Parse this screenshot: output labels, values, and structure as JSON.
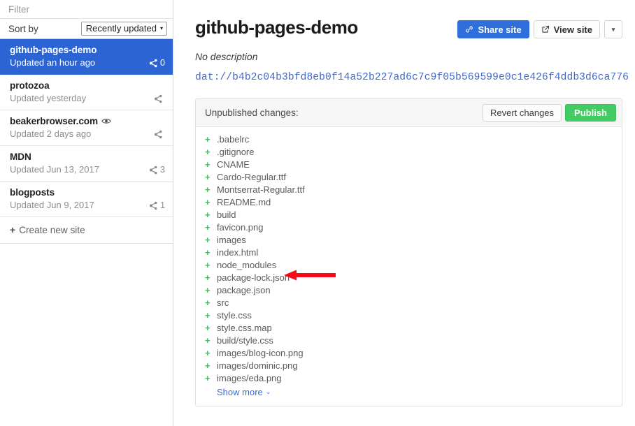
{
  "sidebar": {
    "filter": {
      "placeholder": "Filter",
      "value": ""
    },
    "sort": {
      "label": "Sort by",
      "selected": "Recently updated",
      "caret": "▾"
    },
    "sites": [
      {
        "name": "github-pages-demo",
        "updated": "Updated an hour ago",
        "peers": "0",
        "selected": true,
        "has_eye": false,
        "share_icon": "share-icon"
      },
      {
        "name": "protozoa",
        "updated": "Updated yesterday",
        "peers": "",
        "selected": false,
        "has_eye": false,
        "share_icon": "share-icon"
      },
      {
        "name": "beakerbrowser.com",
        "updated": "Updated 2 days ago",
        "peers": "",
        "selected": false,
        "has_eye": true,
        "share_icon": "share-icon"
      },
      {
        "name": "MDN",
        "updated": "Updated Jun 13, 2017",
        "peers": "3",
        "selected": false,
        "has_eye": false,
        "share_icon": "share-icon"
      },
      {
        "name": "blogposts",
        "updated": "Updated Jun 9, 2017",
        "peers": "1",
        "selected": false,
        "has_eye": false,
        "share_icon": "share-icon"
      }
    ],
    "create_new": {
      "plus": "+",
      "label": "Create new site"
    }
  },
  "main": {
    "title": "github-pages-demo",
    "description": "No description",
    "dat_url": "dat://b4b2c04b3bfd8eb0f14a52b227ad6c7c9f05b569599e0c1e426f4ddb3d6ca776",
    "actions": {
      "share_label": "Share site",
      "share_icon": "link-icon",
      "view_label": "View site",
      "view_icon": "external-link-icon",
      "dropdown_caret": "▾"
    },
    "changes": {
      "heading": "Unpublished changes:",
      "revert_label": "Revert changes",
      "publish_label": "Publish",
      "files": [
        {
          "op": "+",
          "path": ".babelrc"
        },
        {
          "op": "+",
          "path": ".gitignore"
        },
        {
          "op": "+",
          "path": "CNAME"
        },
        {
          "op": "+",
          "path": "Cardo-Regular.ttf"
        },
        {
          "op": "+",
          "path": "Montserrat-Regular.ttf"
        },
        {
          "op": "+",
          "path": "README.md"
        },
        {
          "op": "+",
          "path": "build"
        },
        {
          "op": "+",
          "path": "favicon.png"
        },
        {
          "op": "+",
          "path": "images"
        },
        {
          "op": "+",
          "path": "index.html"
        },
        {
          "op": "+",
          "path": "node_modules"
        },
        {
          "op": "+",
          "path": "package-lock.json"
        },
        {
          "op": "+",
          "path": "package.json"
        },
        {
          "op": "+",
          "path": "src"
        },
        {
          "op": "+",
          "path": "style.css"
        },
        {
          "op": "+",
          "path": "style.css.map"
        },
        {
          "op": "+",
          "path": "build/style.css"
        },
        {
          "op": "+",
          "path": "images/blog-icon.png"
        },
        {
          "op": "+",
          "path": "images/dominic.png"
        },
        {
          "op": "+",
          "path": "images/eda.png"
        }
      ],
      "show_more": {
        "label": "Show more",
        "chevron": "⌄"
      }
    }
  },
  "annotation": {
    "arrow_color": "#fa0a19",
    "points_at": "node_modules"
  },
  "colors": {
    "selected_item": "#2d64d4",
    "primary_button": "#2f6fdb",
    "publish_button": "#43cc63",
    "link": "#3b6ed6",
    "dat_url": "#4169c8",
    "add_marker": "#3cc156"
  }
}
